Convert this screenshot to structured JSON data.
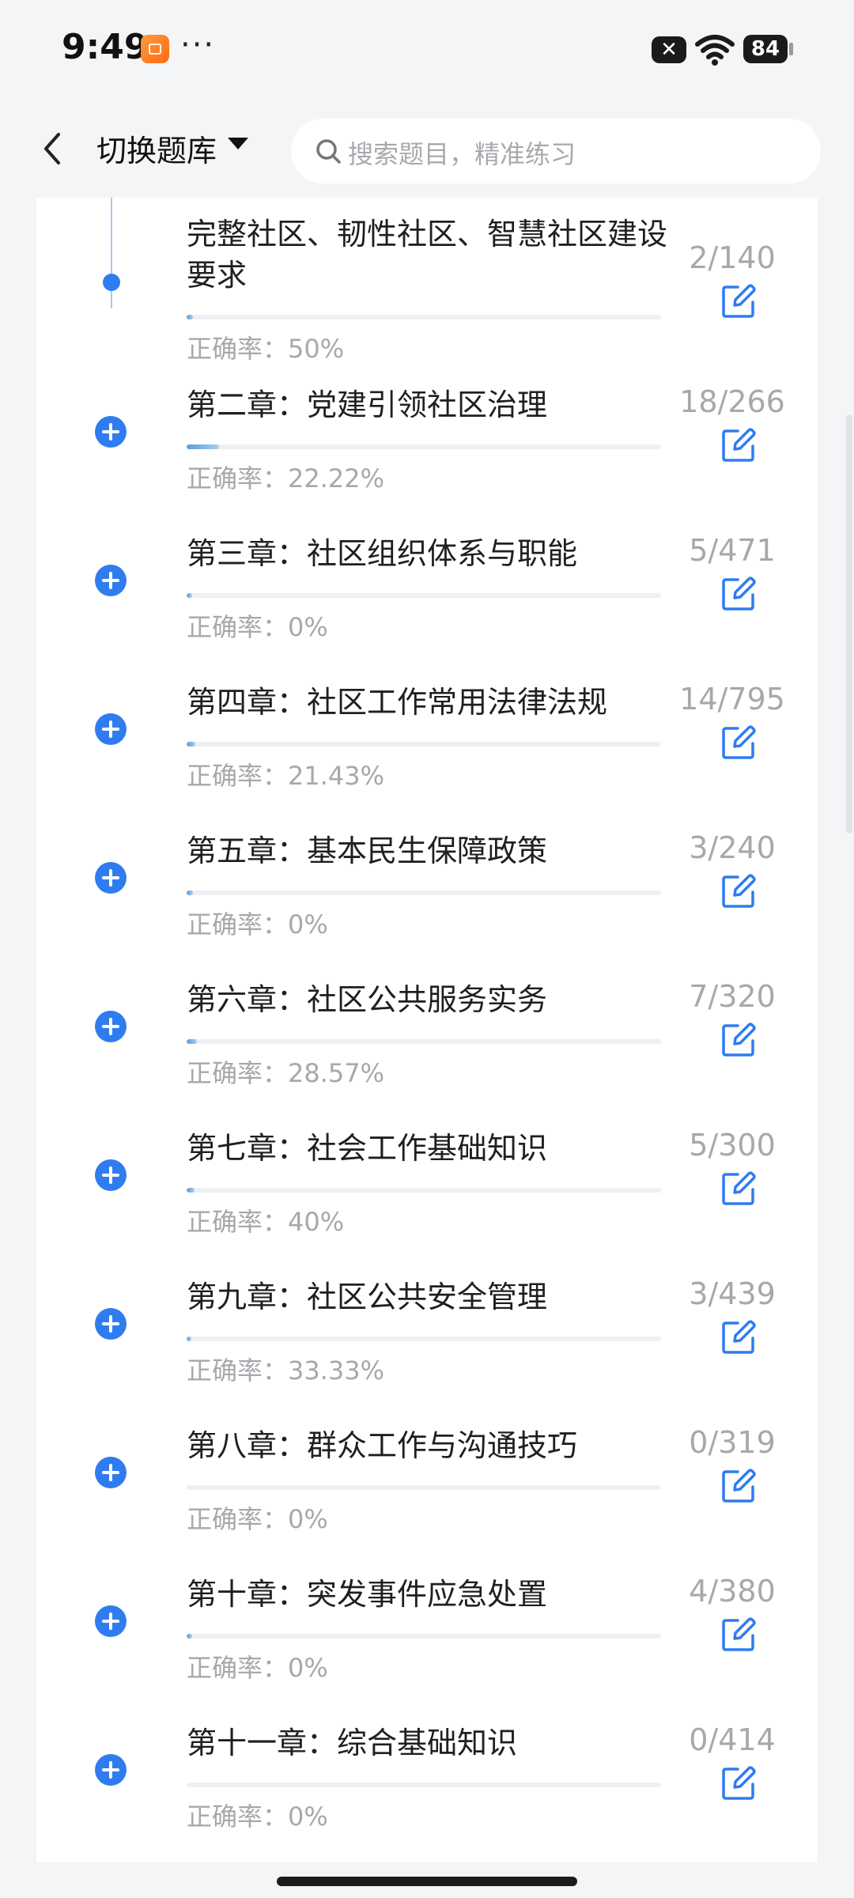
{
  "status_bar": {
    "time": "9:49",
    "dots": "···",
    "badge": "✕",
    "battery": "84"
  },
  "header": {
    "title": "切换题库",
    "search_placeholder": "搜索题目，精准练习"
  },
  "icons": {
    "back": "back-arrow-icon",
    "search": "search-icon",
    "edit": "edit-icon",
    "expand": "plus-circle-icon"
  },
  "colors": {
    "accent": "#2f7cf0",
    "muted": "#a6a8ac",
    "progress": "#5b9bd8"
  },
  "accuracy_label": "正确率：",
  "chapters": [
    {
      "title": "完整社区、韧性社区、智慧社区建设要求",
      "count": "2/140",
      "accuracy": "50%",
      "progress": 0.014
    },
    {
      "title": "第二章：党建引领社区治理",
      "count": "18/266",
      "accuracy": "22.22%",
      "progress": 0.068
    },
    {
      "title": "第三章：社区组织体系与职能",
      "count": "5/471",
      "accuracy": "0%",
      "progress": 0.011
    },
    {
      "title": "第四章：社区工作常用法律法规",
      "count": "14/795",
      "accuracy": "21.43%",
      "progress": 0.018
    },
    {
      "title": "第五章：基本民生保障政策",
      "count": "3/240",
      "accuracy": "0%",
      "progress": 0.013
    },
    {
      "title": "第六章：社区公共服务实务",
      "count": "7/320",
      "accuracy": "28.57%",
      "progress": 0.022
    },
    {
      "title": "第七章：社会工作基础知识",
      "count": "5/300",
      "accuracy": "40%",
      "progress": 0.017
    },
    {
      "title": "第九章：社区公共安全管理",
      "count": "3/439",
      "accuracy": "33.33%",
      "progress": 0.007
    },
    {
      "title": "第八章：群众工作与沟通技巧",
      "count": "0/319",
      "accuracy": "0%",
      "progress": 0
    },
    {
      "title": "第十章：突发事件应急处置",
      "count": "4/380",
      "accuracy": "0%",
      "progress": 0.011
    },
    {
      "title": "第十一章：综合基础知识",
      "count": "0/414",
      "accuracy": "0%",
      "progress": 0
    }
  ]
}
